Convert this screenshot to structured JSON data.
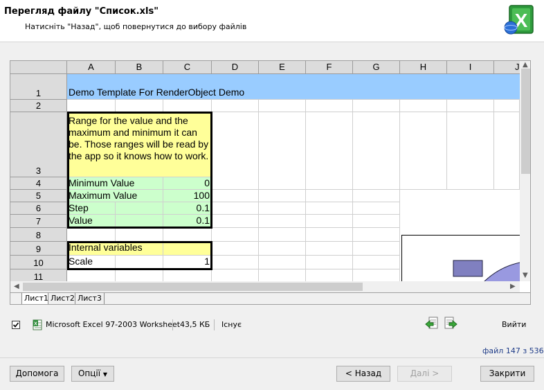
{
  "window": {
    "title": "Перегляд файлу \"Список.xls\"",
    "subtitle": "Натисніть \"Назад\", щоб повернутися до вибору файлів",
    "logo_icon": "excel-logo-icon"
  },
  "sheet": {
    "columns": [
      "A",
      "B",
      "C",
      "D",
      "E",
      "F",
      "G",
      "H",
      "I",
      "J"
    ],
    "rows": [
      "1",
      "2",
      "3",
      "4",
      "5",
      "6",
      "7",
      "8",
      "9",
      "10",
      "11"
    ],
    "cells": {
      "a1": "Demo Template For RenderObject Demo",
      "a3": "Range for the value and the maximum and minimum it can be. Those ranges will be read by the app so it knows how to work.",
      "a4": "Minimum Value",
      "c4": "0",
      "a5": "Maximum Value",
      "c5": "100",
      "a6": "Step",
      "c6": "0.1",
      "a7": "Value",
      "c7": "0.1",
      "a9": "Internal variables",
      "a10": "Scale",
      "c10": "1"
    },
    "tabs": [
      "Лист1",
      "Лист2",
      "Лист3"
    ],
    "colors": {
      "blue": "#99ccff",
      "yellow": "#ffff99",
      "green": "#ccffcc"
    }
  },
  "file_info": {
    "checked": true,
    "type": "Microsoft Excel 97-2003 Worksheet",
    "size": "43,5 КБ",
    "status": "Існує",
    "exit_label": "Вийти",
    "counter": "файл 147 з 536"
  },
  "buttons": {
    "help": "Допомога",
    "options": "Опції",
    "back": "< Назад",
    "next": "Далі >",
    "close": "Закрити"
  }
}
